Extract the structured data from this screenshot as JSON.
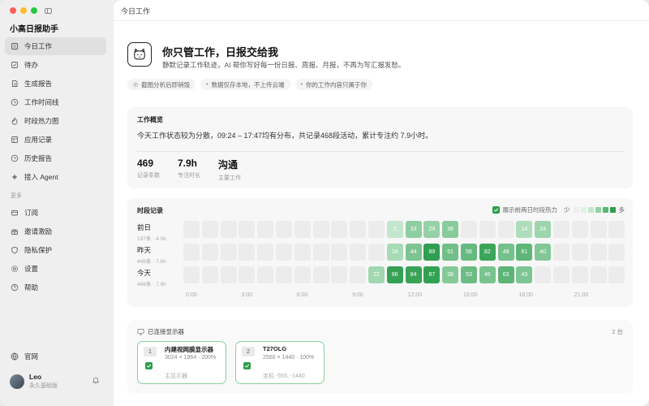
{
  "app": {
    "title": "小高日报助手"
  },
  "sidebar": {
    "items": [
      {
        "label": "今日工作",
        "icon": "home-icon",
        "active": true
      },
      {
        "label": "待办",
        "icon": "todo-icon"
      },
      {
        "label": "生成报告",
        "icon": "report-icon"
      },
      {
        "label": "工作时间线",
        "icon": "clock-icon"
      },
      {
        "label": "时段热力图",
        "icon": "flame-icon"
      },
      {
        "label": "应用记录",
        "icon": "apps-icon"
      },
      {
        "label": "历史报告",
        "icon": "history-icon"
      },
      {
        "label": "接入 Agent",
        "icon": "agent-icon"
      }
    ],
    "section_label": "更多",
    "more_items": [
      {
        "label": "订阅",
        "icon": "subscribe-icon"
      },
      {
        "label": "邀请激励",
        "icon": "gift-icon"
      },
      {
        "label": "隐私保护",
        "icon": "shield-icon"
      },
      {
        "label": "设置",
        "icon": "gear-icon"
      },
      {
        "label": "帮助",
        "icon": "help-icon"
      }
    ],
    "bottom_item": {
      "label": "官网",
      "icon": "globe-icon"
    },
    "user": {
      "name": "Leo",
      "plan": "永久基础版"
    }
  },
  "topbar": {
    "title": "今日工作"
  },
  "hero": {
    "title": "你只管工作，日报交给我",
    "description": "静默记录工作轨迹，AI 帮你写好每一份日报、周报、月报，不再为写汇报发愁。",
    "chips": [
      {
        "icon": "target-icon",
        "label": "截图分析后即销毁"
      },
      {
        "icon": "dot-icon",
        "label": "数据仅存本地，不上传云端"
      },
      {
        "icon": "dot-icon",
        "label": "你的工作内容只属于你"
      }
    ]
  },
  "overview": {
    "title": "工作概览",
    "summary": "今天工作状态较为分散，09:24 – 17:47均有分布，共记录468段活动，累计专注约 7.9小时。",
    "stats": [
      {
        "value": "469",
        "label": "记录条数"
      },
      {
        "value": "7.9h",
        "label": "专注时长"
      },
      {
        "value": "沟通",
        "label": "主要工作"
      }
    ]
  },
  "timeline": {
    "title": "时段记录",
    "legend_label": "展示前两日时段热力",
    "legend_low": "少",
    "legend_high": "多",
    "legend_colors": [
      "#eeeeee",
      "#dff1e4",
      "#c2e6cc",
      "#93d3a6",
      "#57b874",
      "#2e9e4e"
    ],
    "axis_labels": [
      "0:00",
      "3:00",
      "6:00",
      "9:00",
      "12:00",
      "15:00",
      "18:00",
      "21:00"
    ],
    "rows": [
      {
        "name": "前日",
        "sub": "137条 · 4.0h",
        "cells": [
          null,
          null,
          null,
          null,
          null,
          null,
          null,
          null,
          null,
          null,
          null,
          "2",
          "33",
          "29",
          "36",
          null,
          null,
          null,
          "14",
          "24",
          null,
          null,
          null,
          null
        ]
      },
      {
        "name": "昨天",
        "sub": "445条 · 7.6h",
        "cells": [
          null,
          null,
          null,
          null,
          null,
          null,
          null,
          null,
          null,
          null,
          null,
          "18",
          "44",
          "89",
          "51",
          "56",
          "82",
          "48",
          "61",
          "40",
          null,
          null,
          null,
          null
        ]
      },
      {
        "name": "今天",
        "sub": "468条 · 7.9h",
        "cells": [
          null,
          null,
          null,
          null,
          null,
          null,
          null,
          null,
          null,
          null,
          "22",
          "86",
          "84",
          "87",
          "38",
          "53",
          "46",
          "63",
          "43",
          null,
          null,
          null,
          null,
          null
        ]
      }
    ]
  },
  "monitors": {
    "title": "已连接显示器",
    "count": "2 台",
    "items": [
      {
        "num": "1",
        "name": "内建视网膜显示器",
        "res": "3024 × 1964 · 200%",
        "role": "主显示器"
      },
      {
        "num": "2",
        "name": "T27OLG",
        "res": "2560 × 1440 · 100%",
        "role": "坐标 -553, -1440"
      }
    ]
  }
}
